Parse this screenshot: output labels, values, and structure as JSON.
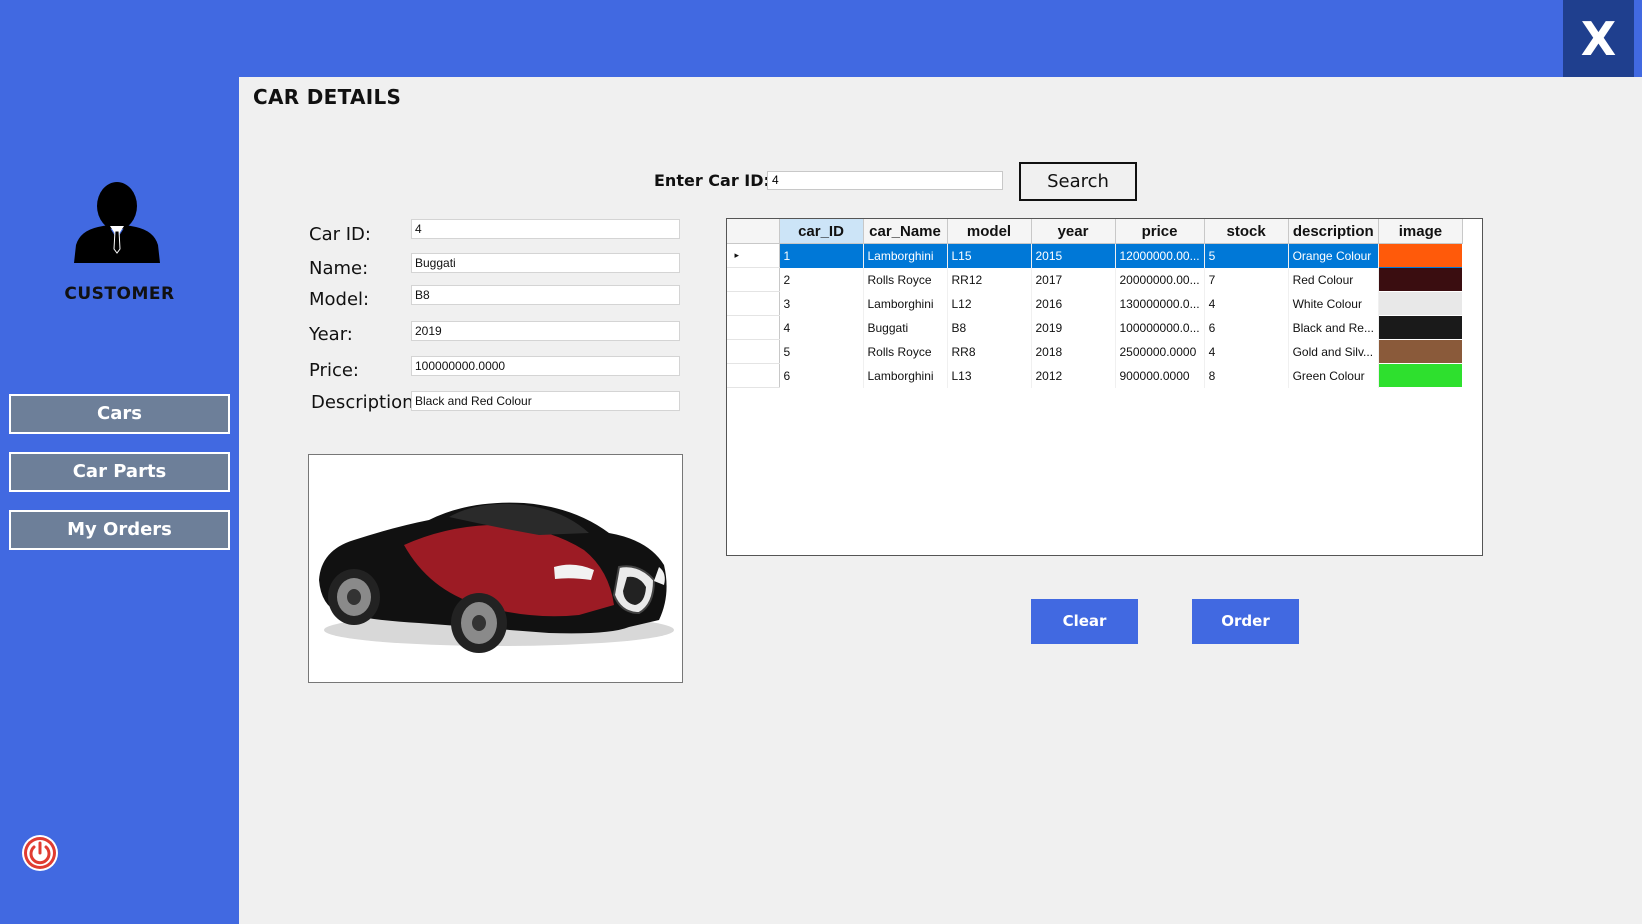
{
  "window": {
    "close_label": "X"
  },
  "sidebar": {
    "role": "CUSTOMER",
    "nav": [
      {
        "label": "Cars"
      },
      {
        "label": "Car Parts"
      },
      {
        "label": "My Orders"
      }
    ]
  },
  "main": {
    "title": "CAR DETAILS",
    "search": {
      "label": "Enter Car ID:",
      "value": "4",
      "button": "Search"
    },
    "form": {
      "car_id_label": "Car ID:",
      "car_id": "4",
      "name_label": "Name:",
      "name": "Buggati",
      "model_label": "Model:",
      "model": "B8",
      "year_label": "Year:",
      "year": "2019",
      "price_label": "Price:",
      "price": "100000000.0000",
      "description_label": "Description",
      "description": "Black and Red Colour"
    },
    "grid": {
      "columns": [
        "car_ID",
        "car_Name",
        "model",
        "year",
        "price",
        "stock",
        "description",
        "image"
      ],
      "rows": [
        {
          "car_ID": "1",
          "car_Name": "Lamborghini",
          "model": "L15",
          "year": "2015",
          "price": "12000000.00...",
          "stock": "5",
          "description": "Orange Colour",
          "image_color": "#ff5a0a",
          "selected": true
        },
        {
          "car_ID": "2",
          "car_Name": "Rolls Royce",
          "model": "RR12",
          "year": "2017",
          "price": "20000000.00...",
          "stock": "7",
          "description": "Red Colour",
          "image_color": "#3a0d10"
        },
        {
          "car_ID": "3",
          "car_Name": "Lamborghini",
          "model": "L12",
          "year": "2016",
          "price": "130000000.0...",
          "stock": "4",
          "description": "White Colour",
          "image_color": "#e8e8e8"
        },
        {
          "car_ID": "4",
          "car_Name": "Buggati",
          "model": "B8",
          "year": "2019",
          "price": "100000000.0...",
          "stock": "6",
          "description": "Black and Re...",
          "image_color": "#1a1a1a"
        },
        {
          "car_ID": "5",
          "car_Name": "Rolls Royce",
          "model": "RR8",
          "year": "2018",
          "price": "2500000.0000",
          "stock": "4",
          "description": "Gold and Silv...",
          "image_color": "#8a5a3a"
        },
        {
          "car_ID": "6",
          "car_Name": "Lamborghini",
          "model": "L13",
          "year": "2012",
          "price": "900000.0000",
          "stock": "8",
          "description": "Green Colour",
          "image_color": "#2ee02e"
        }
      ]
    },
    "buttons": {
      "clear": "Clear",
      "order": "Order"
    }
  },
  "colors": {
    "background": "#4169E1",
    "panel": "#f0f0f0",
    "nav_button": "#6d7f99",
    "selection": "#0078d7",
    "close_button": "#1f3f8e"
  }
}
